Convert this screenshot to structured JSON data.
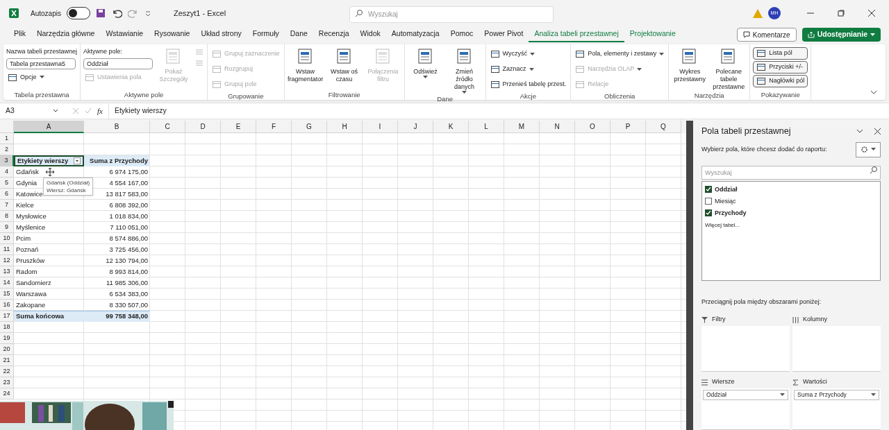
{
  "title_bar": {
    "autosave": {
      "label": "Autozapis",
      "on": false
    },
    "title": "Zeszyt1 - Excel",
    "search_placeholder": "Wyszukaj",
    "avatar": "MH"
  },
  "menu_tabs": [
    {
      "label": "Plik",
      "selected": false,
      "kind": "normal"
    },
    {
      "label": "Narzędzia główne",
      "selected": false,
      "kind": "normal"
    },
    {
      "label": "Wstawianie",
      "selected": false,
      "kind": "normal"
    },
    {
      "label": "Rysowanie",
      "selected": false,
      "kind": "normal"
    },
    {
      "label": "Układ strony",
      "selected": false,
      "kind": "normal"
    },
    {
      "label": "Formuły",
      "selected": false,
      "kind": "normal"
    },
    {
      "label": "Dane",
      "selected": false,
      "kind": "normal"
    },
    {
      "label": "Recenzja",
      "selected": false,
      "kind": "normal"
    },
    {
      "label": "Widok",
      "selected": false,
      "kind": "normal"
    },
    {
      "label": "Automatyzacja",
      "selected": false,
      "kind": "normal"
    },
    {
      "label": "Pomoc",
      "selected": false,
      "kind": "normal"
    },
    {
      "label": "Power Pivot",
      "selected": false,
      "kind": "normal"
    },
    {
      "label": "Analiza tabeli przestawnej",
      "selected": true,
      "kind": "contextual"
    },
    {
      "label": "Projektowanie",
      "selected": false,
      "kind": "contextual"
    }
  ],
  "comments_button": "Komentarze",
  "share_button": "Udostępnianie",
  "ribbon": {
    "groups": [
      {
        "label": "Tabela przestawna",
        "columns": [
          [
            {
              "kind": "caption",
              "label": "Nazwa tabeli przestawnej"
            },
            {
              "kind": "field",
              "value": "Tabela przestawna5"
            },
            {
              "kind": "small",
              "label": "Opcje",
              "disabled": false,
              "dropdown": true
            }
          ]
        ]
      },
      {
        "label": "Aktywne pole",
        "columns": [
          [
            {
              "kind": "caption",
              "label": "Aktywne pole:"
            },
            {
              "kind": "field",
              "value": "Oddział"
            },
            {
              "kind": "small",
              "label": "Ustawienia pola",
              "disabled": true,
              "dropdown": false
            }
          ],
          [
            {
              "kind": "large",
              "label": "Pokaż Szczegóły",
              "disabled": true,
              "dropdown": false
            }
          ],
          [
            {
              "kind": "icon",
              "disabled": true
            },
            {
              "kind": "icon",
              "disabled": true
            }
          ]
        ]
      },
      {
        "label": "Grupowanie",
        "columns": [
          [
            {
              "kind": "small",
              "label": "Grupuj zaznaczenie",
              "disabled": true,
              "dropdown": false
            },
            {
              "kind": "small",
              "label": "Rozgrupuj",
              "disabled": true,
              "dropdown": false
            },
            {
              "kind": "small",
              "label": "Grupuj pole",
              "disabled": true,
              "dropdown": false
            }
          ]
        ]
      },
      {
        "label": "Filtrowanie",
        "columns": [
          [
            {
              "kind": "large",
              "label": "Wstaw fragmentator",
              "disabled": false,
              "dropdown": false
            }
          ],
          [
            {
              "kind": "large",
              "label": "Wstaw oś czasu",
              "disabled": false,
              "dropdown": false
            }
          ],
          [
            {
              "kind": "large",
              "label": "Połączenia filtru",
              "disabled": true,
              "dropdown": false
            }
          ]
        ]
      },
      {
        "label": "Dane",
        "columns": [
          [
            {
              "kind": "large",
              "label": "Odśwież",
              "disabled": false,
              "dropdown": true
            }
          ],
          [
            {
              "kind": "large",
              "label": "Zmień źródło danych",
              "disabled": false,
              "dropdown": true
            }
          ]
        ]
      },
      {
        "label": "Akcje",
        "columns": [
          [
            {
              "kind": "small",
              "label": "Wyczyść",
              "disabled": false,
              "dropdown": true
            },
            {
              "kind": "small",
              "label": "Zaznacz",
              "disabled": false,
              "dropdown": true
            },
            {
              "kind": "small",
              "label": "Przenieś tabelę przest.",
              "disabled": false,
              "dropdown": false
            }
          ]
        ]
      },
      {
        "label": "Obliczenia",
        "columns": [
          [
            {
              "kind": "small",
              "label": "Pola, elementy i zestawy",
              "disabled": false,
              "dropdown": true
            },
            {
              "kind": "small",
              "label": "Narzędzia OLAP",
              "disabled": true,
              "dropdown": true
            },
            {
              "kind": "small",
              "label": "Relacje",
              "disabled": true,
              "dropdown": false
            }
          ]
        ]
      },
      {
        "label": "Narzędzia",
        "columns": [
          [
            {
              "kind": "large",
              "label": "Wykres przestawny",
              "disabled": false,
              "dropdown": false
            }
          ],
          [
            {
              "kind": "large",
              "label": "Polecane tabele przestawne",
              "disabled": false,
              "dropdown": false
            }
          ]
        ]
      },
      {
        "label": "Pokazywanie",
        "columns": [
          [
            {
              "kind": "toggle",
              "label": "Lista pól",
              "selected": true
            },
            {
              "kind": "toggle",
              "label": "Przyciski +/-",
              "selected": true
            },
            {
              "kind": "toggle",
              "label": "Nagłówki pól",
              "selected": true
            }
          ]
        ]
      }
    ]
  },
  "formula_bar": {
    "name_box": "A3",
    "fx": "fx",
    "formula": "Etykiety wierszy"
  },
  "sheet": {
    "columns": [
      {
        "label": "A",
        "selected": true
      },
      {
        "label": "B",
        "selected": false
      },
      {
        "label": "C",
        "selected": false
      },
      {
        "label": "D",
        "selected": false
      },
      {
        "label": "E",
        "selected": false
      },
      {
        "label": "F",
        "selected": false
      },
      {
        "label": "G",
        "selected": false
      },
      {
        "label": "H",
        "selected": false
      },
      {
        "label": "I",
        "selected": false
      },
      {
        "label": "J",
        "selected": false
      },
      {
        "label": "K",
        "selected": false
      },
      {
        "label": "L",
        "selected": false
      },
      {
        "label": "M",
        "selected": false
      },
      {
        "label": "N",
        "selected": false
      },
      {
        "label": "O",
        "selected": false
      },
      {
        "label": "P",
        "selected": false
      },
      {
        "label": "Q",
        "selected": false
      }
    ],
    "rows": [
      {
        "number": "1",
        "selected": false,
        "kind": "empty"
      },
      {
        "number": "2",
        "selected": false,
        "kind": "empty"
      },
      {
        "number": "3",
        "selected": true,
        "kind": "pivot_header",
        "cells": [
          "Etykiety wierszy",
          "Suma z Przychody"
        ]
      },
      {
        "number": "4",
        "selected": false,
        "kind": "pivot_row",
        "cells": [
          "Gdańsk",
          "6 974 175,00"
        ]
      },
      {
        "number": "5",
        "selected": false,
        "kind": "pivot_row",
        "cells": [
          "Gdynia",
          "4 554 167,00"
        ]
      },
      {
        "number": "6",
        "selected": false,
        "kind": "pivot_row",
        "cells": [
          "Katowice",
          "13 817 583,00"
        ]
      },
      {
        "number": "7",
        "selected": false,
        "kind": "pivot_row",
        "cells": [
          "Kielce",
          "6 808 392,00"
        ]
      },
      {
        "number": "8",
        "selected": false,
        "kind": "pivot_row",
        "cells": [
          "Mysłowice",
          "1 018 834,00"
        ]
      },
      {
        "number": "9",
        "selected": false,
        "kind": "pivot_row",
        "cells": [
          "Myślenice",
          "7 110 051,00"
        ]
      },
      {
        "number": "10",
        "selected": false,
        "kind": "pivot_row",
        "cells": [
          "Pcim",
          "8 574 886,00"
        ]
      },
      {
        "number": "11",
        "selected": false,
        "kind": "pivot_row",
        "cells": [
          "Poznań",
          "3 725 456,00"
        ]
      },
      {
        "number": "12",
        "selected": false,
        "kind": "pivot_row",
        "cells": [
          "Pruszków",
          "12 130 794,00"
        ]
      },
      {
        "number": "13",
        "selected": false,
        "kind": "pivot_row",
        "cells": [
          "Radom",
          "8 993 814,00"
        ]
      },
      {
        "number": "14",
        "selected": false,
        "kind": "pivot_row",
        "cells": [
          "Sandomierz",
          "11 985 306,00"
        ]
      },
      {
        "number": "15",
        "selected": false,
        "kind": "pivot_row",
        "cells": [
          "Warszawa",
          "6 534 383,00"
        ]
      },
      {
        "number": "16",
        "selected": false,
        "kind": "pivot_row",
        "cells": [
          "Zakopane",
          "8 330 507,00"
        ]
      },
      {
        "number": "17",
        "selected": false,
        "kind": "pivot_total",
        "cells": [
          "Suma końcowa",
          "99 758 348,00"
        ]
      },
      {
        "number": "18",
        "selected": false,
        "kind": "empty"
      },
      {
        "number": "19",
        "selected": false,
        "kind": "empty"
      },
      {
        "number": "20",
        "selected": false,
        "kind": "empty"
      },
      {
        "number": "21",
        "selected": false,
        "kind": "empty"
      },
      {
        "number": "22",
        "selected": false,
        "kind": "empty"
      },
      {
        "number": "23",
        "selected": false,
        "kind": "empty"
      },
      {
        "number": "24",
        "selected": false,
        "kind": "empty"
      }
    ],
    "tooltip": [
      "Gdańsk (Oddział)",
      "Wiersz: Gdańsk"
    ]
  },
  "field_pane": {
    "title": "Pola tabeli przestawnej",
    "subtitle": "Wybierz pola, które chcesz dodać do raportu:",
    "search_placeholder": "Wyszukaj",
    "fields": [
      {
        "label": "Oddział",
        "checked": true
      },
      {
        "label": "Miesiąc",
        "checked": false
      },
      {
        "label": "Przychody",
        "checked": true
      }
    ],
    "more_tables": "Więcej tabel...",
    "drag_hint": "Przeciągnij pola między obszarami poniżej:",
    "areas": [
      {
        "kind": "filters",
        "label": "Filtry"
      },
      {
        "kind": "columns",
        "label": "Kolumny"
      },
      {
        "kind": "rows",
        "label": "Wiersze",
        "item": "Oddział"
      },
      {
        "kind": "values",
        "label": "Wartości",
        "item": "Suma z Przychody"
      }
    ]
  }
}
